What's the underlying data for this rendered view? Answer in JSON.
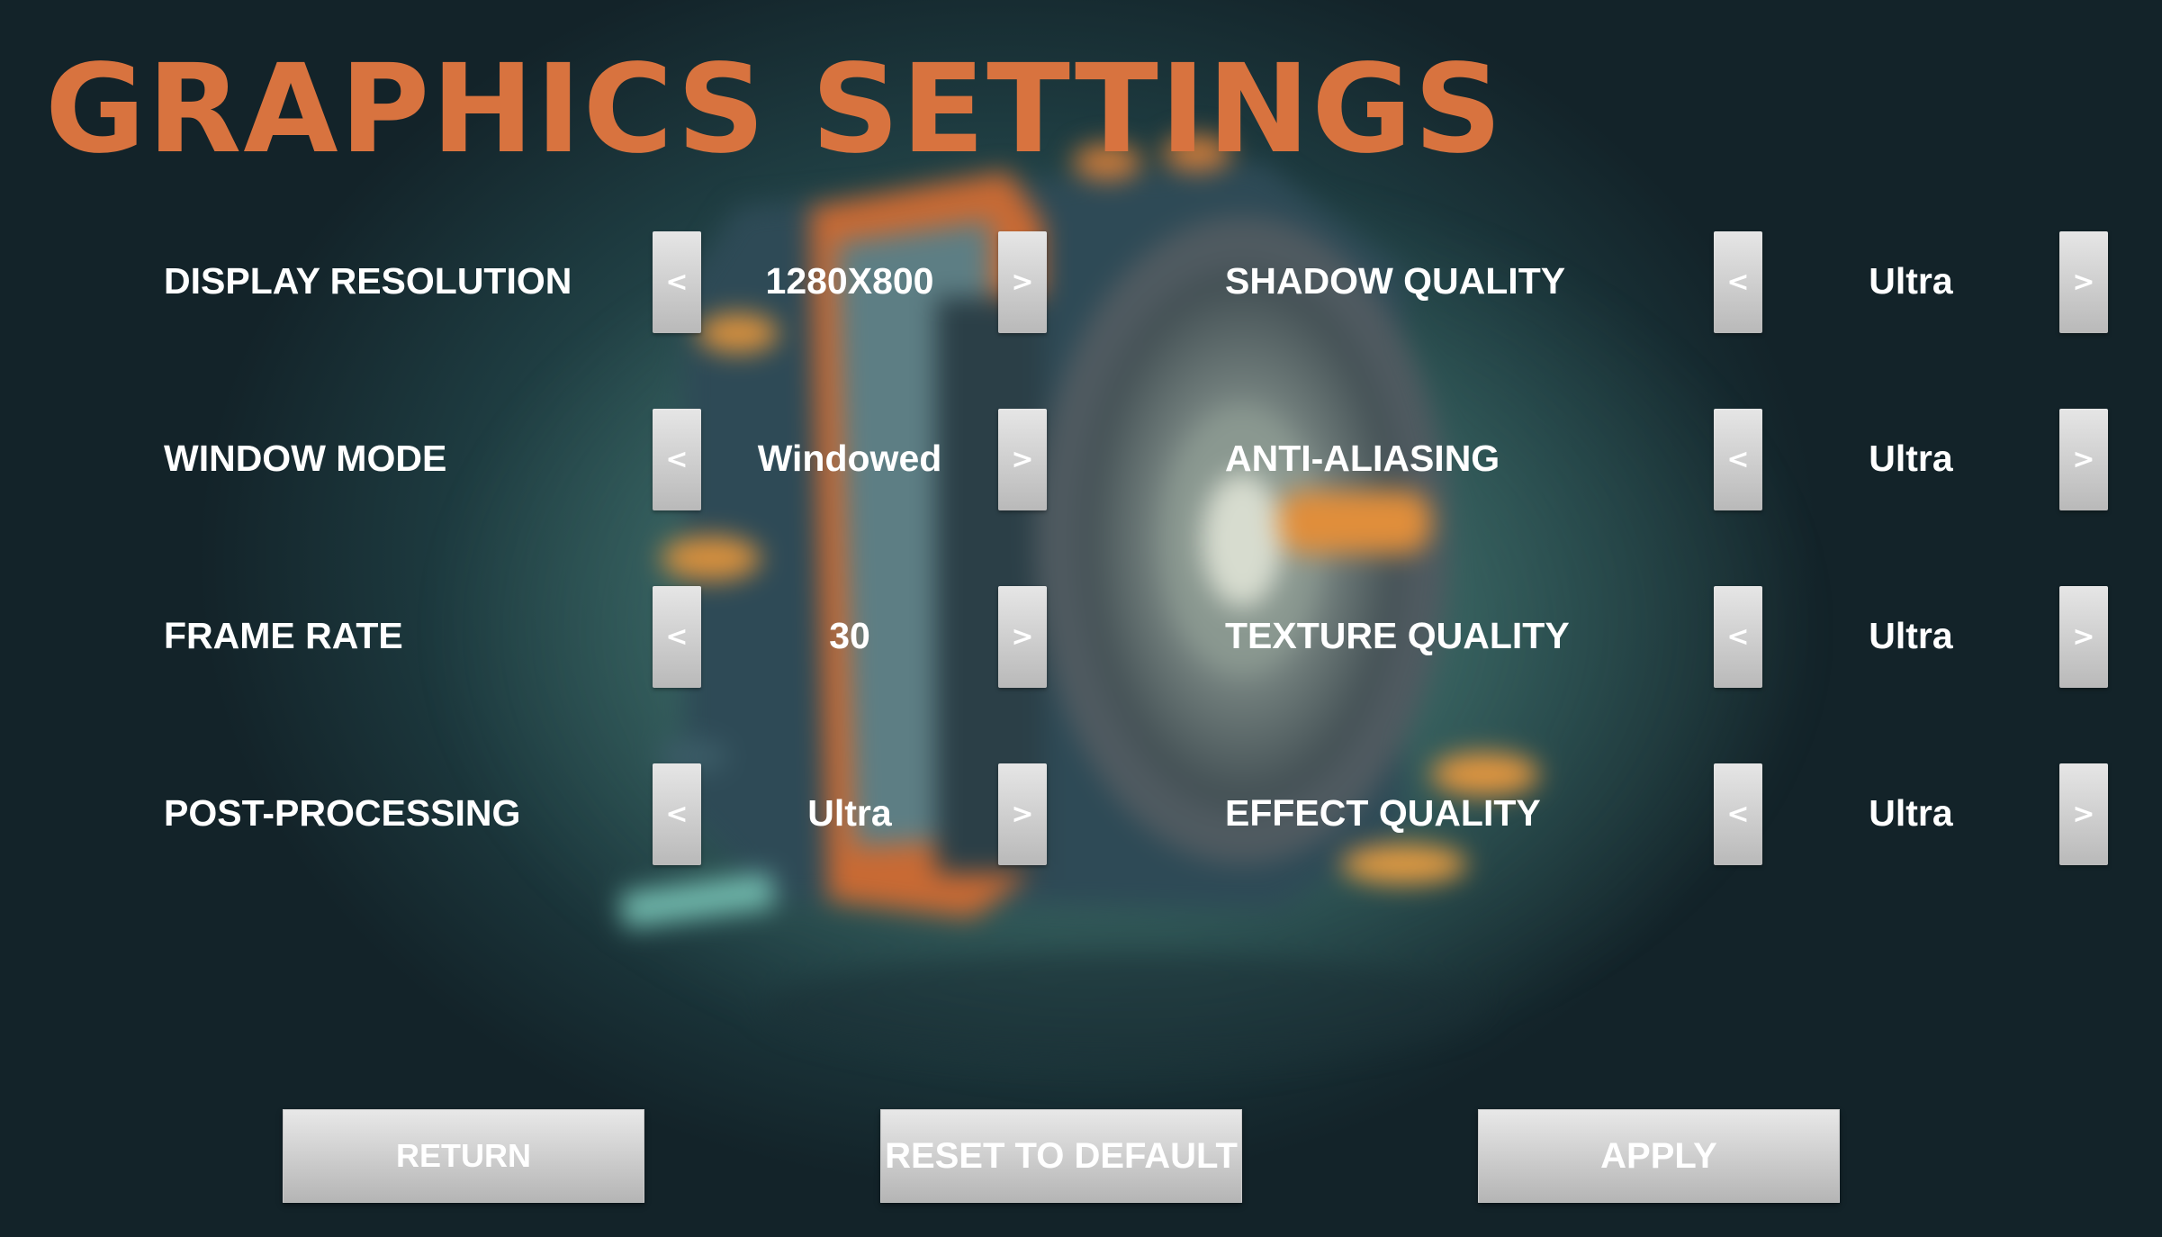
{
  "title": "GRAPHICS SETTINGS",
  "colors": {
    "title": "#d8733f",
    "label": "#ffffff",
    "button_face": "#d0d0d0"
  },
  "left_settings": [
    {
      "label": "DISPLAY RESOLUTION",
      "value": "1280X800"
    },
    {
      "label": "WINDOW MODE",
      "value": "Windowed"
    },
    {
      "label": "FRAME RATE",
      "value": "30"
    },
    {
      "label": "POST-PROCESSING",
      "value": "Ultra"
    }
  ],
  "right_settings": [
    {
      "label": "SHADOW QUALITY",
      "value": "Ultra"
    },
    {
      "label": "ANTI-ALIASING",
      "value": "Ultra"
    },
    {
      "label": "TEXTURE QUALITY",
      "value": "Ultra"
    },
    {
      "label": "EFFECT QUALITY",
      "value": "Ultra"
    }
  ],
  "arrows": {
    "prev_icon": "chevron-left-icon",
    "next_icon": "chevron-right-icon",
    "prev_glyph": "<",
    "next_glyph": ">"
  },
  "buttons": {
    "return_label": "RETURN",
    "reset_label": "RESET TO DEFAULT",
    "apply_label": "APPLY"
  }
}
